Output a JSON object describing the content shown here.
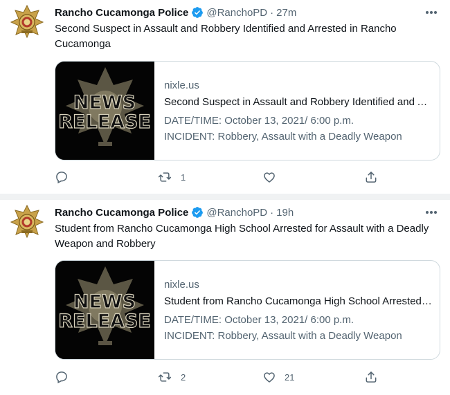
{
  "colors": {
    "verified": "#1d9bf0",
    "secondary_text": "#536471",
    "border": "#cfd9de",
    "divider": "#f0f2f3"
  },
  "tweets": [
    {
      "author": "Rancho Cucamonga Police",
      "handle": "@RanchoPD",
      "separator": "·",
      "time": "27m",
      "text": "Second Suspect in Assault and Robbery Identified and Arrested in Rancho Cucamonga",
      "card": {
        "image_line1": "NEWS",
        "image_line2": "RELEASE",
        "domain": "nixle.us",
        "title": "Second Suspect in Assault and Robbery Identified and Arrested in Rancho Cucamonga",
        "desc_line1": "DATE/TIME: October 13, 2021/ 6:00 p.m.",
        "desc_line2": "INCIDENT: Robbery, Assault with a Deadly Weapon"
      },
      "actions": {
        "reply_count": "",
        "retweet_count": "1",
        "like_count": "",
        "icons": [
          "reply-icon",
          "retweet-icon",
          "like-icon",
          "share-icon"
        ]
      }
    },
    {
      "author": "Rancho Cucamonga Police",
      "handle": "@RanchoPD",
      "separator": "·",
      "time": "19h",
      "text": "Student from Rancho Cucamonga High School Arrested for Assault with a Deadly Weapon and Robbery",
      "card": {
        "image_line1": "NEWS",
        "image_line2": "RELEASE",
        "domain": "nixle.us",
        "title": "Student from Rancho Cucamonga High School Arrested for Assault with a Deadly Weapon",
        "desc_line1": "DATE/TIME: October 13, 2021/ 6:00 p.m.",
        "desc_line2": "INCIDENT: Robbery, Assault with a Deadly Weapon"
      },
      "actions": {
        "reply_count": "",
        "retweet_count": "2",
        "like_count": "21",
        "icons": [
          "reply-icon",
          "retweet-icon",
          "like-icon",
          "share-icon"
        ]
      }
    }
  ]
}
